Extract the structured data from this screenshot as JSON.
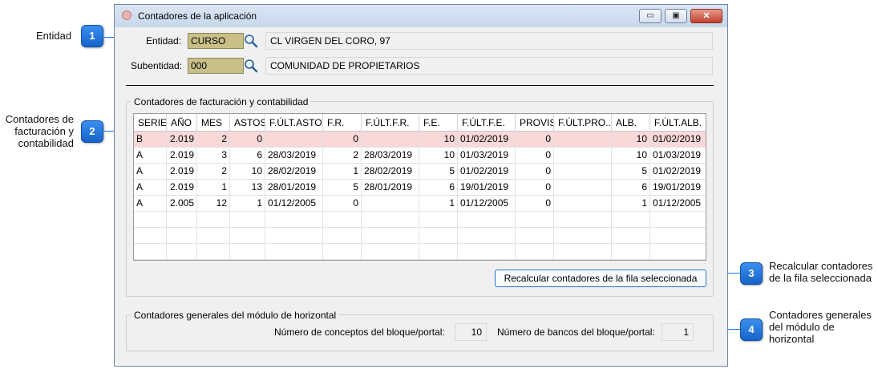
{
  "annotations": [
    {
      "number": "1",
      "label": "Entidad"
    },
    {
      "number": "2",
      "label_lines": [
        "Contadores de",
        "facturación y",
        "contabilidad"
      ]
    },
    {
      "number": "3",
      "label_lines": [
        "Recalcular contadores",
        "de la fila seleccionada"
      ]
    },
    {
      "number": "4",
      "label_lines": [
        "Contadores generales",
        "del módulo de",
        "horizontal"
      ]
    }
  ],
  "window": {
    "title": "Contadores de la aplicación",
    "controls": {
      "minimize": "▭",
      "maximize": "▣",
      "close": "✕"
    }
  },
  "entity": {
    "label": "Entidad:",
    "code": "CURSO",
    "description": "CL VIRGEN DEL CORO, 97"
  },
  "subentity": {
    "label": "Subentidad:",
    "code": "000",
    "description": "COMUNIDAD DE PROPIETARIOS"
  },
  "billing": {
    "group_title": "Contadores de facturación y contabilidad",
    "columns": [
      "SERIE",
      "AÑO",
      "MES",
      "ASTOS.",
      "F.ÚLT.ASTO.",
      "F.R.",
      "F.ÚLT.F.R.",
      "F.E.",
      "F.ÚLT.F.E.",
      "PROVIS.",
      "F.ÚLT.PRO...",
      "ALB.",
      "F.ÚLT.ALB."
    ],
    "rows": [
      [
        "B",
        "2.019",
        "2",
        "0",
        "",
        "0",
        "",
        "10",
        "01/02/2019",
        "0",
        "",
        "10",
        "01/02/2019"
      ],
      [
        "A",
        "2.019",
        "3",
        "6",
        "28/03/2019",
        "2",
        "28/03/2019",
        "10",
        "01/03/2019",
        "0",
        "",
        "10",
        "01/03/2019"
      ],
      [
        "A",
        "2.019",
        "2",
        "10",
        "28/02/2019",
        "1",
        "28/02/2019",
        "5",
        "01/02/2019",
        "0",
        "",
        "5",
        "01/02/2019"
      ],
      [
        "A",
        "2.019",
        "1",
        "13",
        "28/01/2019",
        "5",
        "28/01/2019",
        "6",
        "19/01/2019",
        "0",
        "",
        "6",
        "19/01/2019"
      ],
      [
        "A",
        "2.005",
        "12",
        "1",
        "01/12/2005",
        "0",
        "",
        "1",
        "01/12/2005",
        "0",
        "",
        "1",
        "01/12/2005"
      ]
    ],
    "selected_row": 0,
    "recalc_button": "Recalcular contadores de la fila seleccionada"
  },
  "general": {
    "group_title": "Contadores generales del módulo de horizontal",
    "concepts_label": "Número de conceptos del bloque/portal:",
    "concepts_value": "10",
    "banks_label": "Número de bancos del bloque/portal:",
    "banks_value": "1"
  },
  "colors": {
    "accent": "#1a73e8",
    "selected_row": "#f9d8d8",
    "code_input": "#c9c088"
  },
  "icons": [
    "search-icon",
    "app-icon",
    "minimize-icon",
    "maximize-icon",
    "close-icon"
  ]
}
